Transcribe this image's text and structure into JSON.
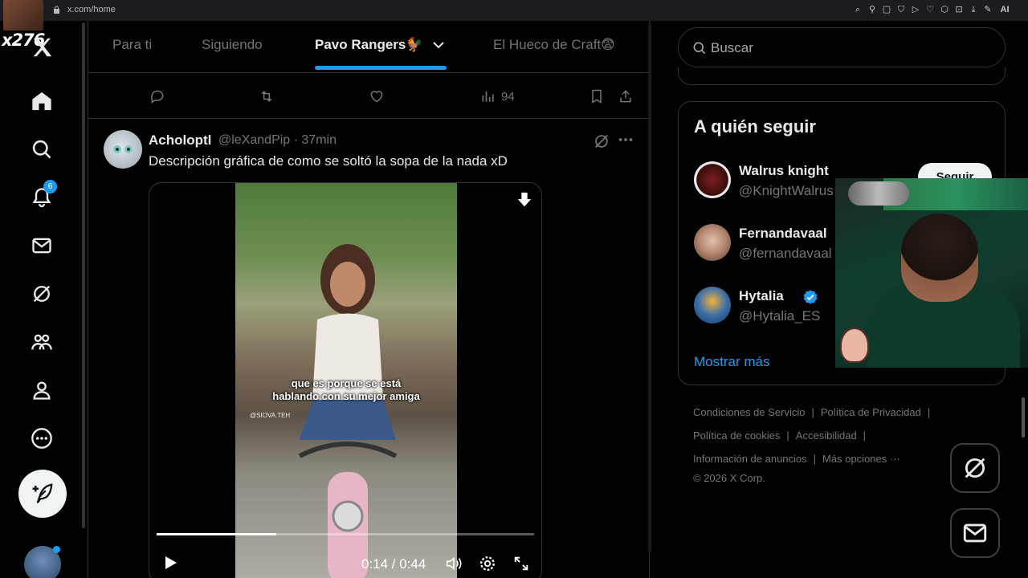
{
  "browser": {
    "url": "x.com/home",
    "extension_ai_label": "AI"
  },
  "overlay": {
    "stream_tag": "x276"
  },
  "nav": {
    "notifications_badge": "6"
  },
  "tabs": [
    {
      "label": "Para ti",
      "active": false
    },
    {
      "label": "Siguiendo",
      "active": false
    },
    {
      "label": "Pavo Rangers🐓",
      "active": true
    },
    {
      "label": "El Hueco de Craft😨",
      "active": false
    }
  ],
  "prev_post_actions": {
    "views": "94"
  },
  "post": {
    "author_name": "Acholoptl",
    "author_handle": "@leXandPip · 37min",
    "text": "Descripción gráfica de como se soltó la sopa de la nada xD",
    "video": {
      "caption": "que es porque se está hablando con su mejor amiga",
      "watermark": "@SIOVA.TEH",
      "time_display": "0:14 / 0:44",
      "progress": 0.318
    }
  },
  "search": {
    "placeholder": "Buscar"
  },
  "who_to_follow": {
    "title": "A quién seguir",
    "follow_label": "Seguir",
    "items": [
      {
        "name": "Walrus knight",
        "handle": "@KnightWalrus",
        "verified": false,
        "avatar_color": "#5a1616"
      },
      {
        "name": "Fernandavaal",
        "handle": "@fernandavaal",
        "verified": false,
        "avatar_color": "#c8a08a"
      },
      {
        "name": "Hytalia",
        "handle": "@Hytalia_ES",
        "verified": true,
        "avatar_color": "#3a6ea8"
      }
    ],
    "show_more": "Mostrar más"
  },
  "footer": {
    "links": [
      "Condiciones de Servicio",
      "Política de Privacidad",
      "Política de cookies",
      "Accesibilidad",
      "Información de anuncios",
      "Más opciones ···"
    ],
    "copyright": "© 2026 X Corp."
  },
  "colors": {
    "accent": "#1d9bf0",
    "background": "#000000",
    "border": "#2f3336",
    "muted_text": "#71767b"
  }
}
